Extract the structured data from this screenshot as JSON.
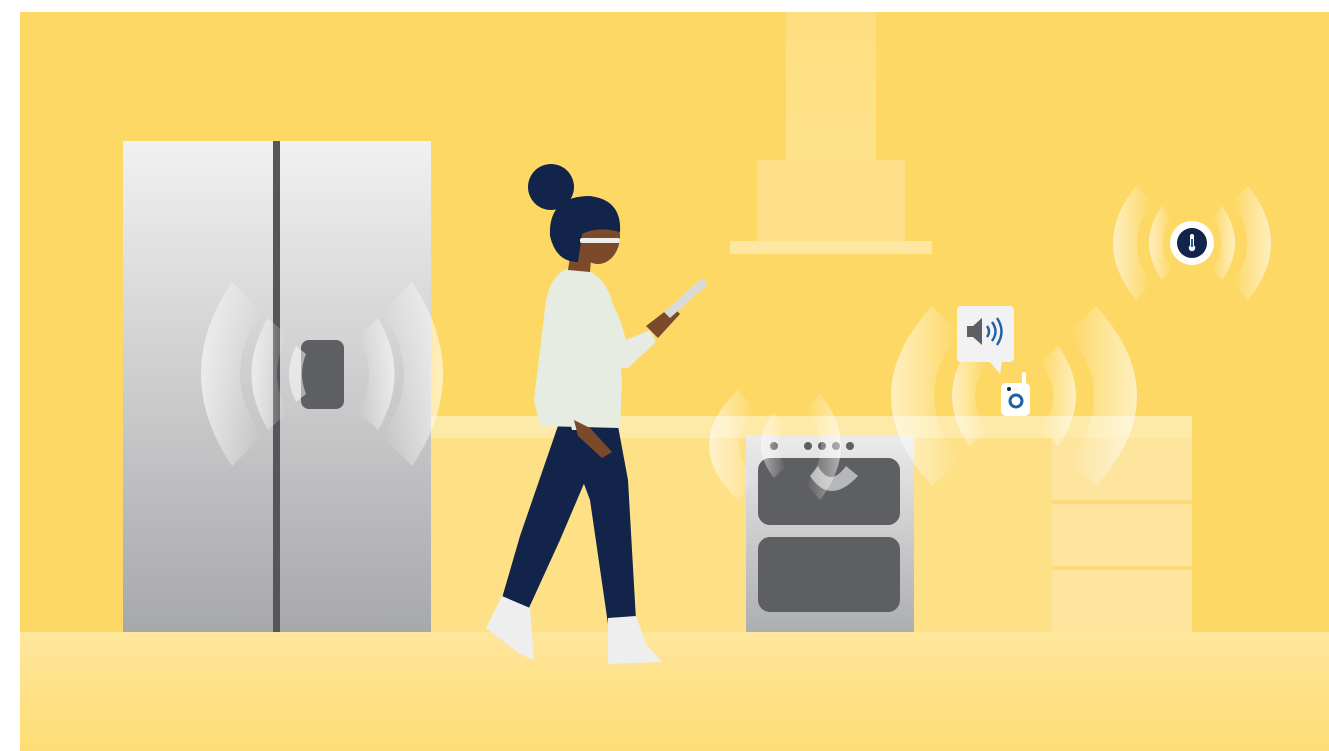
{
  "scene": {
    "colors": {
      "wall": "#FDD864",
      "floor": "#FEE7A0",
      "counter": "#FEE28A",
      "hood": "#FEE38F",
      "steel_light": "#EDEDED",
      "steel_dark": "#A9AAAC",
      "appliance_dark": "#5E5F62",
      "navy": "#13244A",
      "skin": "#7A4A2A",
      "shirt": "#E6ECE1",
      "sock": "#EEEEEE",
      "signal_wave": "#FFFFFF",
      "accent_blue": "#1E5FA8"
    },
    "icons": {
      "fridge_sensor": "smart-sensor-icon",
      "speaker_bubble": "speaker-volume-icon",
      "counter_device": "smart-camera-icon",
      "wall_sensor": "thermometer-icon"
    }
  }
}
